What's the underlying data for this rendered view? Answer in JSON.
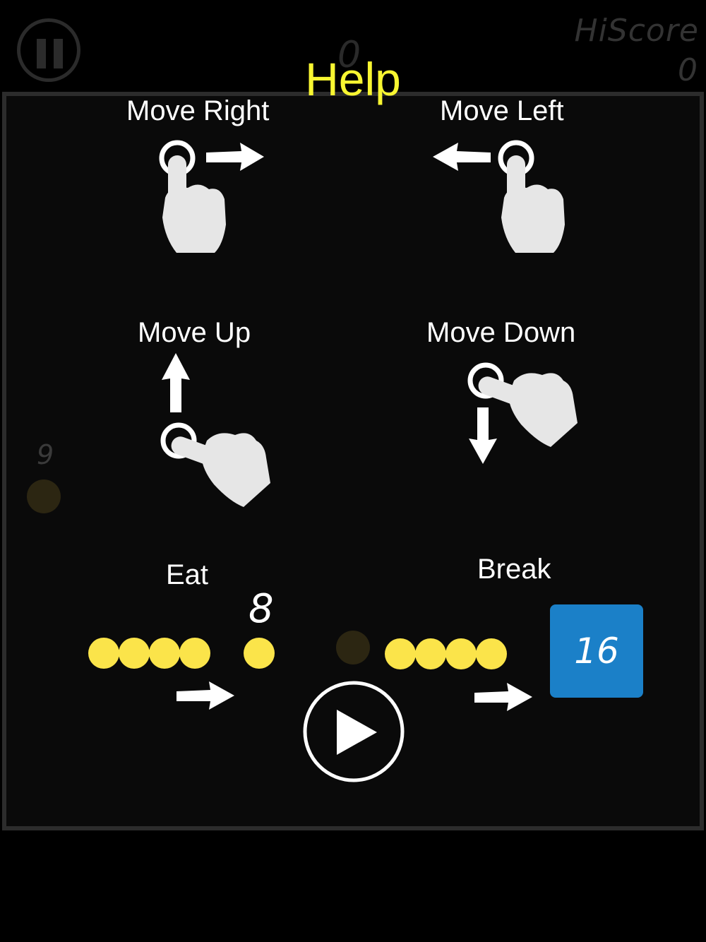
{
  "hud": {
    "hiscore_label": "HiScore",
    "hiscore_value": "0",
    "score": "0",
    "pause_icon": "pause-icon"
  },
  "help": {
    "title": "Help",
    "move_right": "Move Right",
    "move_left": "Move Left",
    "move_up": "Move Up",
    "move_down": "Move Down",
    "eat": "Eat",
    "break": "Break",
    "food_value": "8",
    "block_value": "16",
    "ghost_food_value": "9",
    "play_icon": "play-icon"
  },
  "colors": {
    "title": "#f8f631",
    "food": "#fbe44a",
    "block": "#1b80c8",
    "hand": "#e6e6e6",
    "background": "#000000"
  }
}
